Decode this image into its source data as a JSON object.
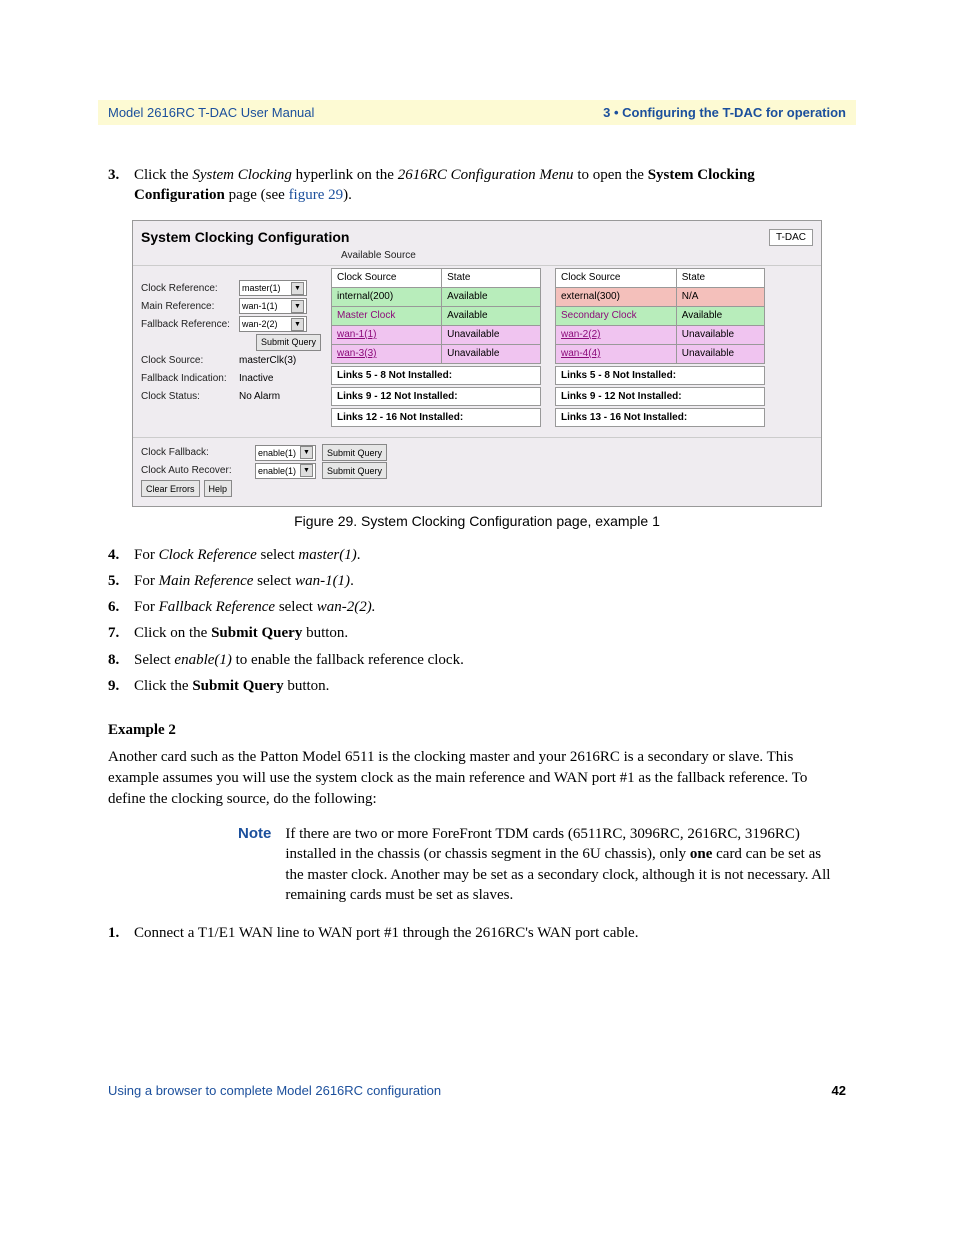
{
  "header": {
    "left": "Model 2616RC T-DAC User Manual",
    "right": "3 • Configuring the T-DAC for operation"
  },
  "step3": {
    "num": "3.",
    "t1": "Click the ",
    "i1": "System Clocking",
    "t2": " hyperlink on the ",
    "i2": "2616RC Configuration Menu",
    "t3": " to open the ",
    "b1": "System Clocking Configuration",
    "t4": " page (see ",
    "link": "figure 29",
    "t5": ")."
  },
  "figure": {
    "title": "System Clocking Configuration",
    "badge": "T-DAC",
    "available_source": "Available Source",
    "left": {
      "clock_reference": {
        "label": "Clock Reference:",
        "value": "master(1)"
      },
      "main_reference": {
        "label": "Main Reference:",
        "value": "wan-1(1)"
      },
      "fallback_reference": {
        "label": "Fallback Reference:",
        "value": "wan-2(2)"
      },
      "submit": "Submit Query",
      "clock_source": {
        "label": "Clock Source:",
        "value": "masterClk(3)"
      },
      "fallback_indication": {
        "label": "Fallback Indication:",
        "value": "Inactive"
      },
      "clock_status": {
        "label": "Clock Status:",
        "value": "No Alarm"
      }
    },
    "table_headers": {
      "source": "Clock Source",
      "state": "State"
    },
    "table_left": {
      "r1": {
        "src": "internal(200)",
        "state": "Available"
      },
      "r2": {
        "src": "Master Clock",
        "state": "Available"
      },
      "r3": {
        "src": "wan-1(1)",
        "state": "Unavailable"
      },
      "r4": {
        "src": "wan-3(3)",
        "state": "Unavailable"
      },
      "n1": "Links 5 - 8 Not Installed:",
      "n2": "Links 9 - 12 Not Installed:",
      "n3": "Links 12 - 16 Not Installed:"
    },
    "table_right": {
      "r1": {
        "src": "external(300)",
        "state": "N/A"
      },
      "r2": {
        "src": "Secondary Clock",
        "state": "Available"
      },
      "r3": {
        "src": "wan-2(2)",
        "state": "Unavailable"
      },
      "r4": {
        "src": "wan-4(4)",
        "state": "Unavailable"
      },
      "n1": "Links 5 - 8 Not Installed:",
      "n2": "Links 9 - 12 Not Installed:",
      "n3": "Links 13 - 16 Not Installed:"
    },
    "bottom": {
      "clock_fallback": {
        "label": "Clock Fallback:",
        "value": "enable(1)"
      },
      "clock_auto_recover": {
        "label": "Clock Auto Recover:",
        "value": "enable(1)"
      },
      "submit": "Submit Query",
      "clear_errors": "Clear Errors",
      "help": "Help"
    }
  },
  "caption": "Figure 29. System Clocking Configuration page, example 1",
  "step4": {
    "num": "4.",
    "t1": "For ",
    "i1": "Clock Reference",
    "t2": " select ",
    "i2": "master(1)",
    "t3": "."
  },
  "step5": {
    "num": "5.",
    "t1": "For ",
    "i1": "Main Reference",
    "t2": " select ",
    "i2": "wan-1(1)",
    "t3": "."
  },
  "step6": {
    "num": "6.",
    "t1": "For ",
    "i1": "Fallback Reference",
    "t2": " select ",
    "i2": "wan-2(2).",
    "t3": ""
  },
  "step7": {
    "num": "7.",
    "t1": "Click on the ",
    "b1": "Submit Query",
    "t2": " button."
  },
  "step8": {
    "num": "8.",
    "t1": "Select ",
    "i1": "enable(1)",
    "t2": " to enable the fallback reference clock."
  },
  "step9": {
    "num": "9.",
    "t1": "Click the ",
    "b1": "Submit Query",
    "t2": " button."
  },
  "example2": {
    "head": "Example 2",
    "para": "Another card such as the Patton Model 6511 is the clocking master and your 2616RC is a secondary or slave. This example assumes you will use the system clock as the main reference and WAN port #1 as the fallback reference. To define the clocking source, do the following:"
  },
  "note": {
    "label": "Note",
    "t1": "If there are two or more ForeFront TDM cards (6511RC, 3096RC, 2616RC, 3196RC) installed in the chassis (or chassis segment in the 6U chassis), only ",
    "b1": "one",
    "t2": " card can be set as the master clock.  Another may be set as a secondary clock, although it is not necessary.  All remaining cards must be set as slaves."
  },
  "step1b": {
    "num": "1.",
    "t1": "Connect a T1/E1 WAN line to WAN port #1 through the 2616RC's WAN port cable."
  },
  "footer": {
    "left": "Using a browser to complete Model 2616RC configuration",
    "right": "42"
  }
}
